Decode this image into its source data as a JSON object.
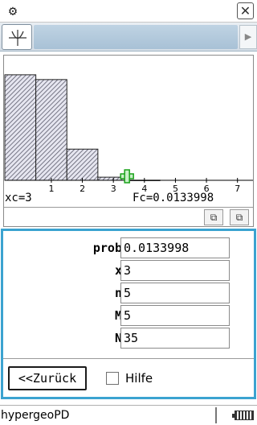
{
  "topbar": {
    "settings_icon": "gear-icon",
    "close_glyph": "✕",
    "settings_glyph": "⚙"
  },
  "toolbar": {
    "graph_icon": "graph-axes-icon",
    "scroll_glyph": "▶"
  },
  "graph": {
    "x_tick_labels": [
      "1",
      "2",
      "3",
      "4",
      "5",
      "6",
      "7"
    ],
    "readout_xc": "xc=3",
    "readout_fc": "Fc=0.0133998",
    "copy_icon": "copy-icon",
    "paste_icon": "paste-icon",
    "copy_glyph": "⧉",
    "paste_glyph": "⧉"
  },
  "chart_data": {
    "type": "bar",
    "categories": [
      "0",
      "1",
      "2",
      "3",
      "4",
      "5",
      "6",
      "7"
    ],
    "values": [
      0.44,
      0.42,
      0.13,
      0.013,
      0.0005,
      0,
      0,
      0
    ],
    "xlim": [
      -0.5,
      7.5
    ],
    "ylim": [
      0,
      0.5
    ],
    "cursor": {
      "x": 3,
      "y": 0.0133998
    },
    "grid": false
  },
  "dialog": {
    "fields": [
      {
        "label": "prob",
        "value": "0.0133998"
      },
      {
        "label": "x",
        "value": "3"
      },
      {
        "label": "n",
        "value": "5"
      },
      {
        "label": "M",
        "value": "5"
      },
      {
        "label": "N",
        "value": "35"
      }
    ],
    "back_label": "<<Zurück",
    "help_label": "Hilfe",
    "help_checked": false
  },
  "status": {
    "app_name": "hypergeoPD",
    "battery_icon": "battery-icon"
  }
}
